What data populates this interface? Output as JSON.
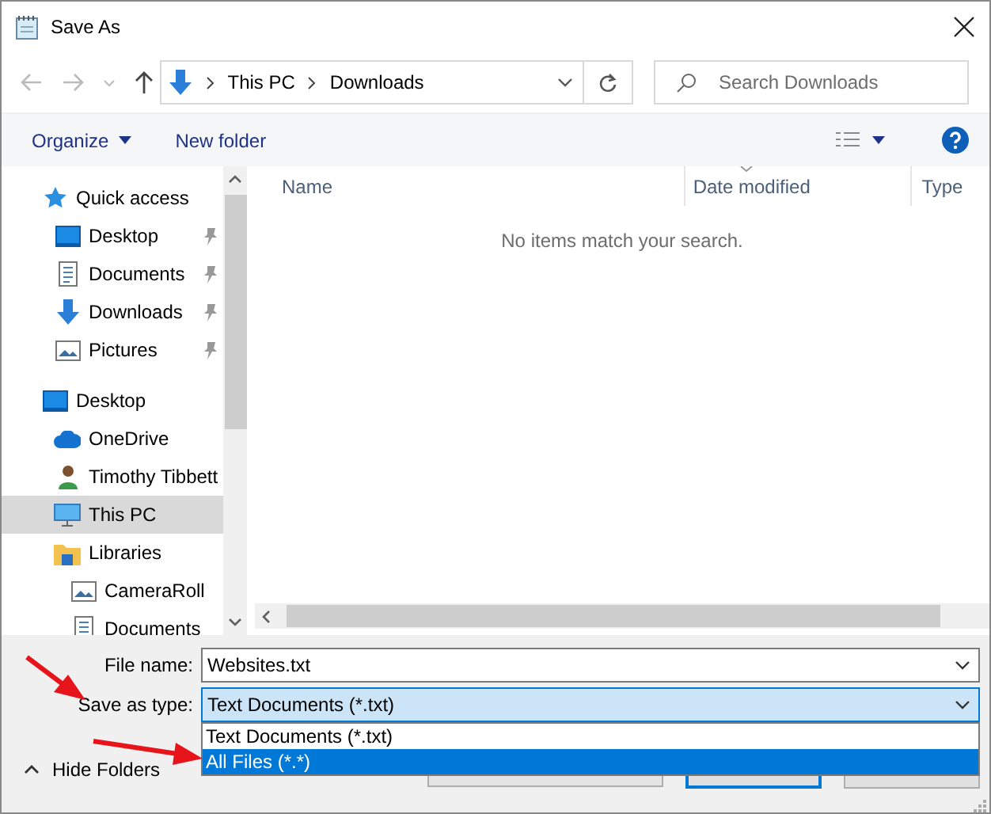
{
  "window": {
    "title": "Save As"
  },
  "nav": {
    "path": [
      {
        "label": "This PC"
      },
      {
        "label": "Downloads"
      }
    ],
    "search": {
      "placeholder": "Search Downloads"
    }
  },
  "toolbar": {
    "organize": "Organize",
    "new_folder": "New folder"
  },
  "sidebar": {
    "items": [
      {
        "label": "Quick access",
        "kind": "star",
        "selected": false,
        "pinned": false,
        "children": [
          {
            "label": "Desktop",
            "kind": "monitor",
            "selected": false,
            "pinned": true
          },
          {
            "label": "Documents",
            "kind": "document",
            "selected": false,
            "pinned": true
          },
          {
            "label": "Downloads",
            "kind": "download",
            "selected": false,
            "pinned": true
          },
          {
            "label": "Pictures",
            "kind": "picture",
            "selected": false,
            "pinned": true
          }
        ]
      },
      {
        "label": "Desktop",
        "kind": "monitor",
        "selected": false,
        "pinned": false,
        "children": [
          {
            "label": "OneDrive",
            "kind": "cloud",
            "selected": false,
            "pinned": false
          },
          {
            "label": "Timothy Tibbett",
            "kind": "person",
            "selected": false,
            "pinned": false
          },
          {
            "label": "This PC",
            "kind": "pc",
            "selected": true,
            "pinned": false
          },
          {
            "label": "Libraries",
            "kind": "folder",
            "selected": false,
            "pinned": false,
            "children": [
              {
                "label": "CameraRoll",
                "kind": "picture",
                "selected": false,
                "pinned": false
              },
              {
                "label": "Documents",
                "kind": "document",
                "selected": false,
                "pinned": false
              }
            ]
          }
        ]
      }
    ]
  },
  "table": {
    "columns": [
      {
        "label": "Name",
        "sorted": false
      },
      {
        "label": "Date modified",
        "sorted": true
      },
      {
        "label": "Type",
        "sorted": false
      }
    ],
    "empty_message": "No items match your search."
  },
  "footer": {
    "file_name": {
      "label": "File name:",
      "value": "Websites.txt"
    },
    "save_type": {
      "label": "Save as type:",
      "value": "Text Documents (*.txt)",
      "expanded": true,
      "options": [
        {
          "label": "Text Documents (*.txt)",
          "highlighted": false
        },
        {
          "label": "All Files  (*.*)",
          "highlighted": true
        }
      ]
    },
    "hide_folders": "Hide Folders"
  }
}
